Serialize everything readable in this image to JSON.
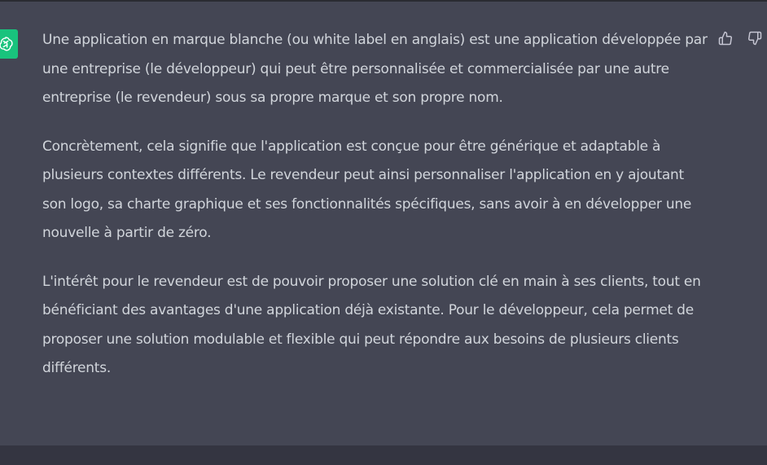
{
  "colors": {
    "page_background": "#343541",
    "message_background": "#444654",
    "avatar_accent": "#19c37d",
    "text": "#d1d5db"
  },
  "icons": {
    "avatar": "openai-logo-icon",
    "like": "thumbs-up-icon",
    "dislike": "thumbs-down-icon"
  },
  "message": {
    "paragraphs": [
      "Une application en marque blanche (ou white label en anglais) est une application développée par une entreprise (le développeur) qui peut être personnalisée et commercialisée par une autre entreprise (le revendeur) sous sa propre marque et son propre nom.",
      "Concrètement, cela signifie que l'application est conçue pour être générique et adaptable à plusieurs contextes différents. Le revendeur peut ainsi personnaliser l'application en y ajoutant son logo, sa charte graphique et ses fonctionnalités spécifiques, sans avoir à en développer une nouvelle à partir de zéro.",
      "L'intérêt pour le revendeur est de pouvoir proposer une solution clé en main à ses clients, tout en bénéficiant des avantages d'une application déjà existante. Pour le développeur, cela permet de proposer une solution modulable et flexible qui peut répondre aux besoins de plusieurs clients différents."
    ]
  }
}
